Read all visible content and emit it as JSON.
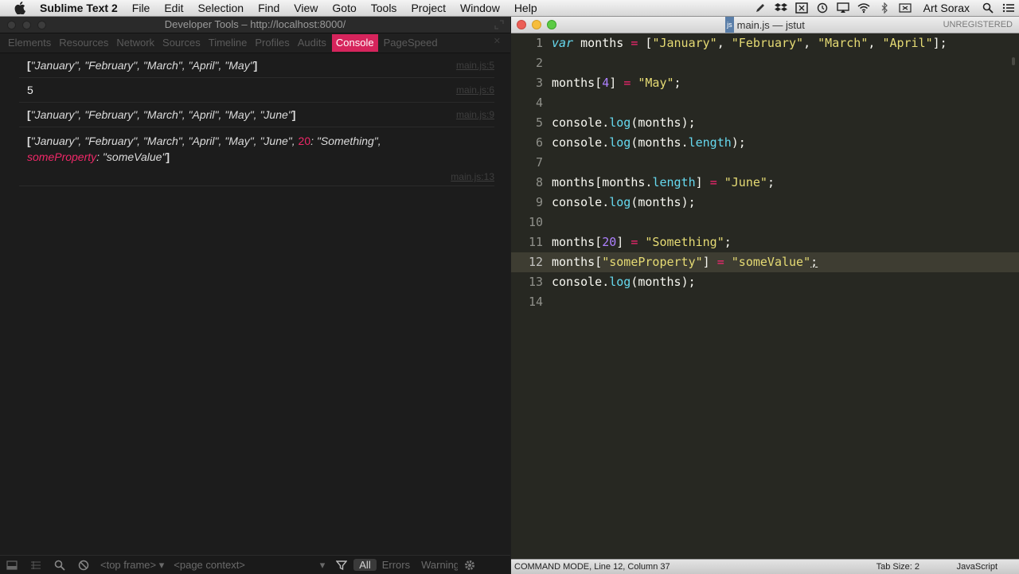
{
  "menubar": {
    "app_name": "Sublime Text 2",
    "items": [
      "File",
      "Edit",
      "Selection",
      "Find",
      "View",
      "Goto",
      "Tools",
      "Project",
      "Window",
      "Help"
    ],
    "user": "Art Sorax"
  },
  "devtools": {
    "title": "Developer Tools – http://localhost:8000/",
    "tabs": [
      "Elements",
      "Resources",
      "Network",
      "Sources",
      "Timeline",
      "Profiles",
      "Audits",
      "Console",
      "PageSpeed"
    ],
    "active_tab": "Console",
    "logs": [
      {
        "text": "\"January\", \"February\", \"March\", \"April\", \"May\"",
        "source": "main.js:5"
      },
      {
        "text": "5",
        "source": "main.js:6"
      },
      {
        "text": "\"January\", \"February\", \"March\", \"April\", \"May\", \"June\"",
        "source": "main.js:9"
      },
      {
        "text": "\"January\", \"February\", \"March\", \"April\", \"May\", \"June\", ",
        "index_key": "20",
        "index_value": ": \"Something\",",
        "prop_key": "someProperty",
        "prop_value": ": \"someValue\"",
        "source": "main.js:13"
      }
    ],
    "bottom": {
      "frame_select": "<top frame>",
      "context_select": "<page context>",
      "filters": [
        "All",
        "Errors",
        "Warnings"
      ]
    }
  },
  "sublime": {
    "title": "main.js — jstut",
    "file_badge": "js",
    "unregistered": "UNREGISTERED",
    "status": {
      "mode": "COMMAND MODE, Line 12, Column 37",
      "tab_size": "Tab Size: 2",
      "syntax": "JavaScript"
    },
    "line_numbers": [
      "1",
      "2",
      "3",
      "4",
      "5",
      "6",
      "7",
      "8",
      "9",
      "10",
      "11",
      "12",
      "13",
      "14"
    ],
    "code": {
      "l1_kw": "var",
      "l1_id": " months ",
      "l1_eq": "=",
      "l1_open": " [",
      "l1_s1": "\"January\"",
      "l1_s2": "\"February\"",
      "l1_s3": "\"March\"",
      "l1_s4": "\"April\"",
      "l1_close": "];",
      "months": "months",
      "idx4": "4",
      "may": "\"May\"",
      "console": "console",
      "log": "log",
      "length": "length",
      "june": "\"June\"",
      "idx20": "20",
      "something": "\"Something\"",
      "someprop": "\"someProperty\"",
      "somevalue": "\"someValue\""
    }
  }
}
